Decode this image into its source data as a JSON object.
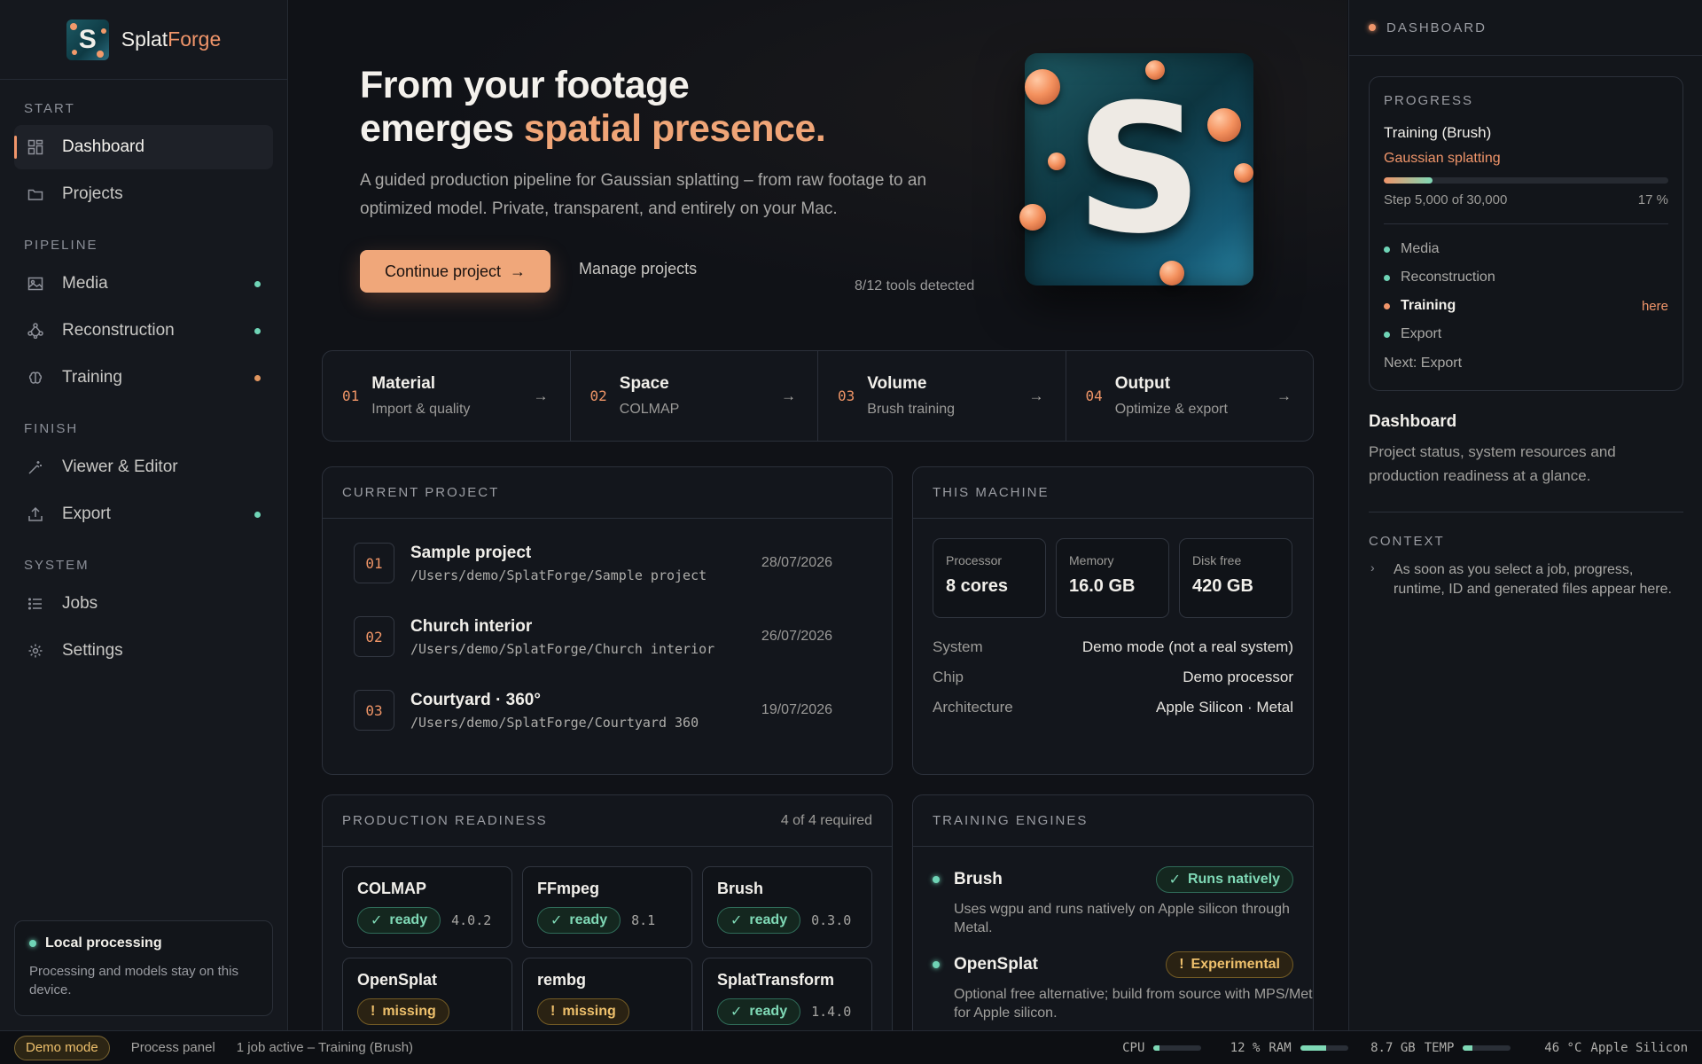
{
  "brand": {
    "name_prefix": "Splat",
    "name_suffix": "Forge",
    "logo_letter": "S"
  },
  "sidebar": {
    "sections": {
      "start": "START",
      "pipeline": "PIPELINE",
      "finish": "FINISH",
      "system": "SYSTEM"
    },
    "items": [
      {
        "label": "Dashboard",
        "icon": "grid-icon",
        "active": true
      },
      {
        "label": "Projects",
        "icon": "folder-icon"
      },
      {
        "label": "Media",
        "icon": "image-icon",
        "status_color": "#6fd4b6"
      },
      {
        "label": "Reconstruction",
        "icon": "nodes-icon",
        "status_color": "#6fd4b6"
      },
      {
        "label": "Training",
        "icon": "brain-icon",
        "status_color": "#e0955f"
      },
      {
        "label": "Viewer & Editor",
        "icon": "magic-wand-icon"
      },
      {
        "label": "Export",
        "icon": "upload-icon",
        "status_color": "#6fd4b6"
      },
      {
        "label": "Jobs",
        "icon": "list-icon"
      },
      {
        "label": "Settings",
        "icon": "gear-icon"
      }
    ],
    "local_card": {
      "title": "Local processing",
      "description": "Processing and models stay on this device."
    }
  },
  "hero": {
    "title_line1": "From your footage",
    "title_line2_plain": "emerges ",
    "title_line2_accent": "spatial presence.",
    "subtitle": "A guided production pipeline for Gaussian splatting – from raw footage to an optimized model. Private, transparent, and entirely on your Mac.",
    "primary_button": "Continue project",
    "secondary_link": "Manage projects",
    "tools_detected": "8/12 tools detected",
    "logo_letter": "S"
  },
  "steps": [
    {
      "num": "01",
      "title": "Material",
      "subtitle": "Import & quality"
    },
    {
      "num": "02",
      "title": "Space",
      "subtitle": "COLMAP"
    },
    {
      "num": "03",
      "title": "Volume",
      "subtitle": "Brush training"
    },
    {
      "num": "04",
      "title": "Output",
      "subtitle": "Optimize & export"
    }
  ],
  "current_project": {
    "title": "CURRENT PROJECT",
    "projects": [
      {
        "num": "01",
        "name": "Sample project",
        "path": "/Users/demo/SplatForge/Sample project",
        "date": "28/07/2026"
      },
      {
        "num": "02",
        "name": "Church interior",
        "path": "/Users/demo/SplatForge/Church interior",
        "date": "26/07/2026"
      },
      {
        "num": "03",
        "name": "Courtyard · 360°",
        "path": "/Users/demo/SplatForge/Courtyard 360",
        "date": "19/07/2026"
      }
    ]
  },
  "machine": {
    "title": "THIS MACHINE",
    "stats": [
      {
        "label": "Processor",
        "value": "8 cores"
      },
      {
        "label": "Memory",
        "value": "16.0 GB"
      },
      {
        "label": "Disk free",
        "value": "420 GB"
      }
    ],
    "details": [
      {
        "key": "System",
        "value": "Demo mode (not a real system)"
      },
      {
        "key": "Chip",
        "value": "Demo processor"
      },
      {
        "key": "Architecture",
        "value": "Apple Silicon · Metal"
      }
    ]
  },
  "readiness": {
    "title": "PRODUCTION READINESS",
    "meta": "4 of 4 required",
    "tools": [
      {
        "name": "COLMAP",
        "status": "ready",
        "version": "4.0.2"
      },
      {
        "name": "FFmpeg",
        "status": "ready",
        "version": "8.1"
      },
      {
        "name": "Brush",
        "status": "ready",
        "version": "0.3.0"
      },
      {
        "name": "OpenSplat",
        "status": "missing",
        "version": ""
      },
      {
        "name": "rembg",
        "status": "missing",
        "version": ""
      },
      {
        "name": "SplatTransform",
        "status": "ready",
        "version": "1.4.0"
      }
    ]
  },
  "engines": {
    "title": "TRAINING ENGINES",
    "items": [
      {
        "name": "Brush",
        "badge": "Runs natively",
        "badge_kind": "native",
        "description": "Uses wgpu and runs natively on Apple silicon through Metal."
      },
      {
        "name": "OpenSplat",
        "badge": "Experimental",
        "badge_kind": "experimental",
        "description": "Optional free alternative; build from source with MPS/Metal for Apple silicon."
      }
    ]
  },
  "right_panel": {
    "header": "DASHBOARD",
    "progress": {
      "label": "PROGRESS",
      "job": "Training (Brush)",
      "engine": "Gaussian splatting",
      "step_text": "Step 5,000 of 30,000",
      "percent_text": "17 %",
      "fraction": 0.17,
      "stages": [
        {
          "label": "Media",
          "state": "done"
        },
        {
          "label": "Reconstruction",
          "state": "done"
        },
        {
          "label": "Training",
          "state": "current",
          "marker": "here"
        },
        {
          "label": "Export",
          "state": "done"
        }
      ],
      "next": "Next: Export"
    },
    "title": "Dashboard",
    "description": "Project status, system resources and production readiness at a glance.",
    "context_label": "CONTEXT",
    "context_text": "As soon as you select a job, progress, runtime, ID and generated files appear here."
  },
  "statusbar": {
    "demo": "Demo mode",
    "panel_link": "Process panel",
    "job": "1 job active – Training (Brush)",
    "cpu_label": "CPU",
    "cpu_text": "12 %",
    "cpu_fraction": 0.12,
    "ram_label": "RAM",
    "ram_text": "8.7 GB",
    "ram_fraction": 0.55,
    "temp_label": "TEMP",
    "temp_text": "46 °C",
    "temp_fraction": 0.2,
    "arch": "Apple Silicon"
  },
  "colors": {
    "accent": "#f0956a",
    "ok": "#6fd4b6",
    "warn": "#eec06c"
  }
}
